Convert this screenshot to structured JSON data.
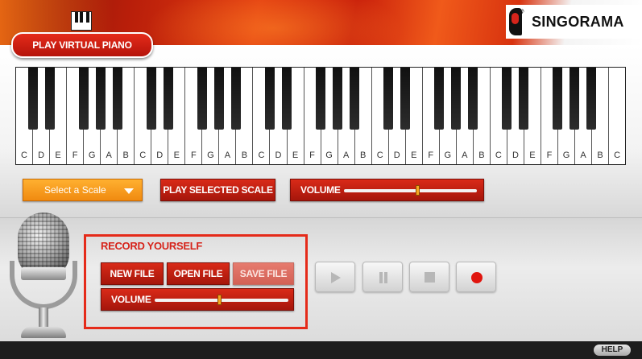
{
  "header": {
    "title": "PLAY VIRTUAL PIANO",
    "brand": "SINGORAMA"
  },
  "keyboard": {
    "white_keys": [
      "C",
      "D",
      "E",
      "F",
      "G",
      "A",
      "B",
      "C",
      "D",
      "E",
      "F",
      "G",
      "A",
      "B",
      "C",
      "D",
      "E",
      "F",
      "G",
      "A",
      "B",
      "C",
      "D",
      "E",
      "F",
      "G",
      "A",
      "B",
      "C",
      "D",
      "E",
      "F",
      "G",
      "A",
      "B",
      "C"
    ]
  },
  "controls": {
    "scale_select": "Select a Scale",
    "play_scale": "PLAY SELECTED SCALE",
    "volume_label": "VOLUME",
    "volume_level": 0.55
  },
  "recorder": {
    "title": "RECORD YOURSELF",
    "new_file": "NEW FILE",
    "open_file": "OPEN FILE",
    "save_file": "SAVE FILE",
    "volume_label": "VOLUME",
    "volume_level": 0.48,
    "transport": [
      "play-icon",
      "pause-icon",
      "stop-icon",
      "record-icon"
    ]
  },
  "footer": {
    "help": "HELP"
  },
  "colors": {
    "accent_red": "#d6241b",
    "select_orange": "#f5a023",
    "record_red": "#e0150e"
  }
}
